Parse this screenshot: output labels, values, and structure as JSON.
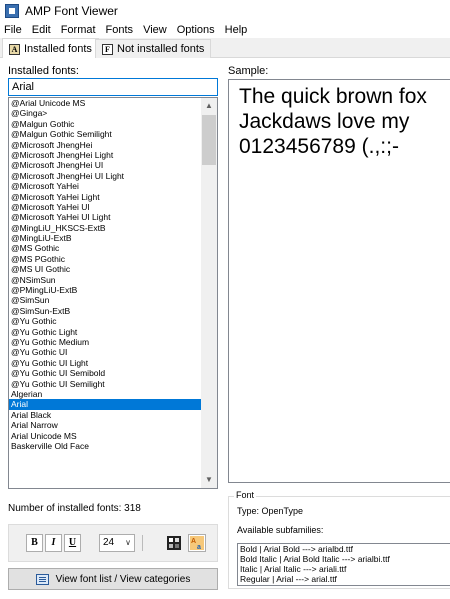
{
  "window": {
    "title": "AMP Font Viewer"
  },
  "menu": [
    "File",
    "Edit",
    "Format",
    "Fonts",
    "View",
    "Options",
    "Help"
  ],
  "tabs": [
    {
      "label": "Installed fonts",
      "active": true
    },
    {
      "label": "Not installed fonts",
      "active": false
    }
  ],
  "installed": {
    "label": "Installed fonts:",
    "search_value": "Arial",
    "items": [
      "@Arial Unicode MS",
      "@Ginga>",
      "@Malgun Gothic",
      "@Malgun Gothic Semilight",
      "@Microsoft JhengHei",
      "@Microsoft JhengHei Light",
      "@Microsoft JhengHei UI",
      "@Microsoft JhengHei UI Light",
      "@Microsoft YaHei",
      "@Microsoft YaHei Light",
      "@Microsoft YaHei UI",
      "@Microsoft YaHei UI Light",
      "@MingLiU_HKSCS-ExtB",
      "@MingLiU-ExtB",
      "@MS Gothic",
      "@MS PGothic",
      "@MS UI Gothic",
      "@NSimSun",
      "@PMingLiU-ExtB",
      "@SimSun",
      "@SimSun-ExtB",
      "@Yu Gothic",
      "@Yu Gothic Light",
      "@Yu Gothic Medium",
      "@Yu Gothic UI",
      "@Yu Gothic UI Light",
      "@Yu Gothic UI Semibold",
      "@Yu Gothic UI Semilight",
      "Algerian",
      "Arial",
      "Arial Black",
      "Arial Narrow",
      "Arial Unicode MS",
      "Baskerville Old Face"
    ],
    "selected_index": 29,
    "scroll_thumb_fraction": 0.14,
    "count_label": "Number of installed fonts:  318"
  },
  "format": {
    "bold": "B",
    "italic": "I",
    "underline": "U",
    "size": "24",
    "color_icon": "font-color-icon",
    "style_icon": "text-style-icon"
  },
  "view_button": {
    "label": "View font list / View categories",
    "icon": "list-icon"
  },
  "sample": {
    "label": "Sample:",
    "lines": [
      "The quick brown fox",
      "Jackdaws love my",
      "0123456789 (.,:;-"
    ]
  },
  "font_info": {
    "group_title": "Font",
    "type": "Type:  OpenType",
    "subfamilies_label": "Available subfamilies:",
    "subfamilies": [
      "Bold  |  Arial Bold  --->  arialbd.ttf",
      "Bold Italic  |  Arial Bold Italic  --->  arialbi.ttf",
      "Italic  |  Arial Italic  --->  ariali.ttf",
      "Regular  |  Arial  --->  arial.ttf"
    ]
  },
  "colors": {
    "accent": "#0078d7",
    "selection_text": "#ffffff"
  }
}
